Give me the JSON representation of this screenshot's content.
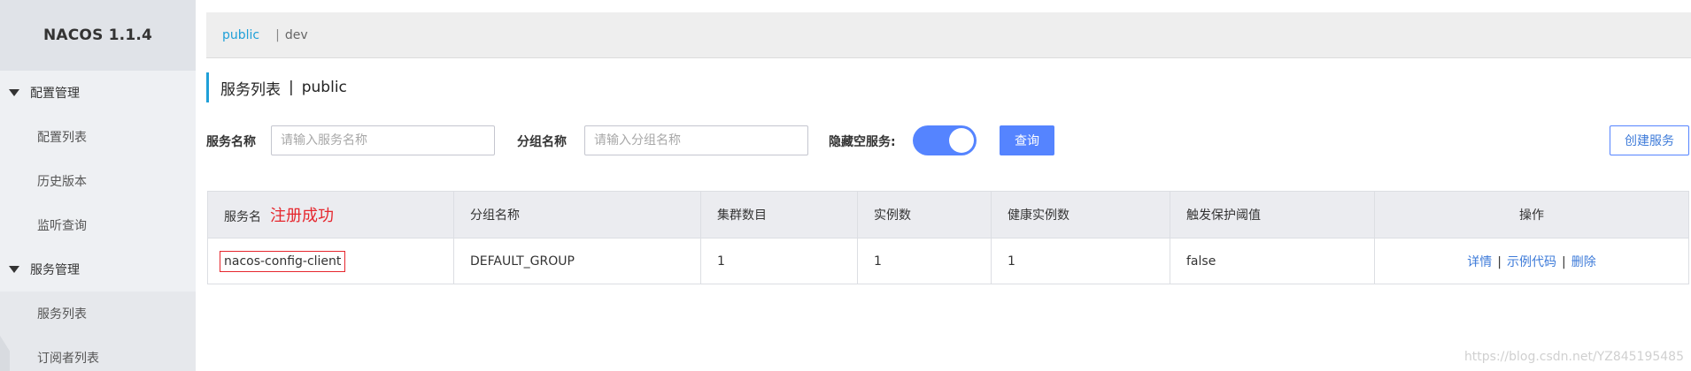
{
  "app": {
    "title": "NACOS 1.1.4"
  },
  "sidebar": {
    "groups": [
      {
        "label": "配置管理",
        "items": [
          {
            "label": "配置列表"
          },
          {
            "label": "历史版本"
          },
          {
            "label": "监听查询"
          }
        ]
      },
      {
        "label": "服务管理",
        "items": [
          {
            "label": "服务列表"
          },
          {
            "label": "订阅者列表"
          }
        ]
      }
    ]
  },
  "namespaces": {
    "active": "public",
    "separator": "|",
    "other": "dev"
  },
  "page": {
    "title": "服务列表",
    "separator": "|",
    "namespace": "public"
  },
  "filters": {
    "service_name_label": "服务名称",
    "service_name_placeholder": "请输入服务名称",
    "group_name_label": "分组名称",
    "group_name_placeholder": "请输入分组名称",
    "hide_empty_label": "隐藏空服务:",
    "hide_empty_enabled": true,
    "query_label": "查询",
    "create_label": "创建服务"
  },
  "table": {
    "columns": [
      "服务名",
      "分组名称",
      "集群数目",
      "实例数",
      "健康实例数",
      "触发保护阈值",
      "操作"
    ],
    "annotation": "注册成功",
    "rows": [
      {
        "service_name": "nacos-config-client",
        "group_name": "DEFAULT_GROUP",
        "cluster_count": "1",
        "instance_count": "1",
        "healthy_instance_count": "1",
        "protect_threshold": "false",
        "actions": {
          "detail": "详情",
          "example": "示例代码",
          "delete": "删除",
          "separator": "|"
        }
      }
    ]
  },
  "watermark": "https://blog.csdn.net/YZ845195485",
  "colors": {
    "accent": "#5584ff",
    "link": "#3e7bd9",
    "namespace_active": "#1fa0d8",
    "annotation": "#e6272e"
  }
}
